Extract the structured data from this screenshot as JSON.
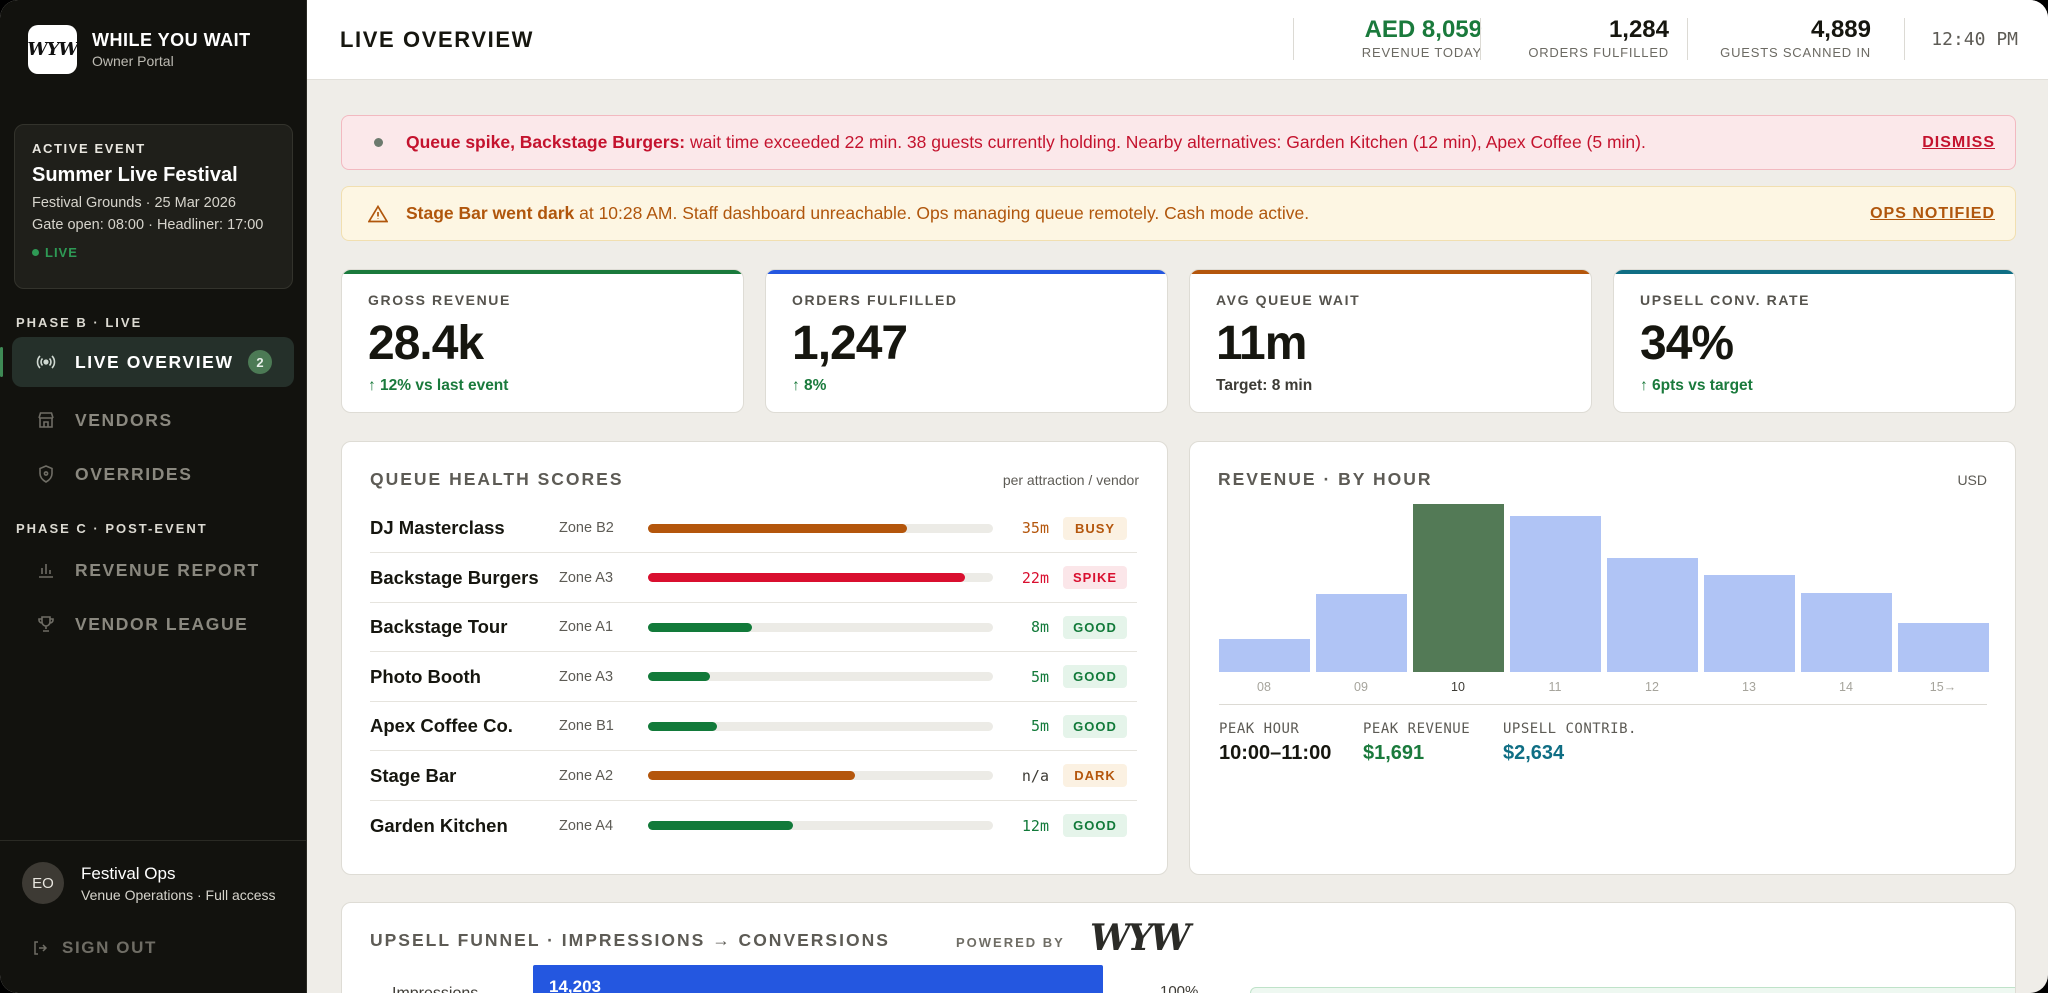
{
  "brand": {
    "logo": "WYW",
    "name": "WHILE YOU WAIT",
    "subtitle": "Owner Portal"
  },
  "event": {
    "kicker": "ACTIVE EVENT",
    "name": "Summer Live Festival",
    "venue_date": "Festival Grounds · 25 Mar 2026",
    "times": "Gate open: 08:00 · Headliner: 17:00",
    "status": "LIVE"
  },
  "nav": {
    "phase_b": "PHASE B · LIVE",
    "phase_c": "PHASE C · POST-EVENT",
    "items": [
      {
        "label": "LIVE OVERVIEW",
        "icon": "broadcast-icon",
        "badge": "2",
        "active": true
      },
      {
        "label": "VENDORS",
        "icon": "store-icon"
      },
      {
        "label": "OVERRIDES",
        "icon": "shield-icon"
      },
      {
        "label": "REVENUE REPORT",
        "icon": "bar-chart-icon"
      },
      {
        "label": "VENDOR LEAGUE",
        "icon": "trophy-icon"
      }
    ]
  },
  "user": {
    "initials": "EO",
    "name": "Festival Ops",
    "role": "Venue Operations · Full access",
    "signout": "SIGN OUT"
  },
  "header": {
    "title": "LIVE OVERVIEW",
    "stats": [
      {
        "value": "AED 8,059",
        "label": "REVENUE TODAY"
      },
      {
        "value": "1,284",
        "label": "ORDERS FULFILLED"
      },
      {
        "value": "4,889",
        "label": "GUESTS SCANNED IN"
      }
    ],
    "clock": "12:40 PM"
  },
  "alerts": {
    "queue": {
      "bold": "Queue spike, Backstage Burgers:",
      "text": " wait time exceeded 22 min. 38 guests currently holding. Nearby alternatives: Garden Kitchen (12 min), Apex Coffee (5 min).",
      "action": "DISMISS"
    },
    "stage": {
      "bold": "Stage Bar went dark",
      "text": " at 10:28 AM. Staff dashboard unreachable. Ops managing queue remotely. Cash mode active.",
      "action": "OPS NOTIFIED"
    }
  },
  "kpis": [
    {
      "label": "GROSS REVENUE",
      "value": "28.4k",
      "sub": "↑ 12% vs last event",
      "accent": "#1a7a3c",
      "sub_color": "#1a7a3c"
    },
    {
      "label": "ORDERS FULFILLED",
      "value": "1,247",
      "sub": "↑ 8%",
      "accent": "#2457e0",
      "sub_color": "#1a7a3c"
    },
    {
      "label": "AVG QUEUE WAIT",
      "value": "11m",
      "sub": "Target: 8 min",
      "accent": "#b4560c",
      "sub_color": "#3d3b35"
    },
    {
      "label": "UPSELL CONV. RATE",
      "value": "34%",
      "sub": "↑ 6pts vs target",
      "accent": "#0f6e84",
      "sub_color": "#1a7a3c"
    }
  ],
  "queue": {
    "title": "QUEUE HEALTH SCORES",
    "note": "per attraction / vendor",
    "rows": [
      {
        "name": "DJ Masterclass",
        "zone": "Zone B2",
        "fill": 0.75,
        "time": "35m",
        "status": "BUSY",
        "color": "#b4560c",
        "tag_bg": "#fbf1e2"
      },
      {
        "name": "Backstage Burgers",
        "zone": "Zone A3",
        "fill": 0.92,
        "time": "22m",
        "status": "SPIKE",
        "color": "#d90f2f",
        "tag_bg": "#fbe6e9"
      },
      {
        "name": "Backstage Tour",
        "zone": "Zone A1",
        "fill": 0.3,
        "time": "8m",
        "status": "GOOD",
        "color": "#127a3a",
        "tag_bg": "#e5f4ea"
      },
      {
        "name": "Photo Booth",
        "zone": "Zone A3",
        "fill": 0.18,
        "time": "5m",
        "status": "GOOD",
        "color": "#127a3a",
        "tag_bg": "#e5f4ea"
      },
      {
        "name": "Apex Coffee Co.",
        "zone": "Zone B1",
        "fill": 0.2,
        "time": "5m",
        "status": "GOOD",
        "color": "#127a3a",
        "tag_bg": "#e5f4ea"
      },
      {
        "name": "Stage Bar",
        "zone": "Zone A2",
        "fill": 0.6,
        "time": "n/a",
        "status": "DARK",
        "color": "#b4560c",
        "tag_bg": "#fbf1e2",
        "time_color": "#3d3b35"
      },
      {
        "name": "Garden Kitchen",
        "zone": "Zone A4",
        "fill": 0.42,
        "time": "12m",
        "status": "GOOD",
        "color": "#127a3a",
        "tag_bg": "#e5f4ea"
      }
    ]
  },
  "revenue": {
    "title": "REVENUE · BY HOUR",
    "unit": "USD",
    "stats": [
      {
        "label": "PEAK HOUR",
        "value": "10:00–11:00",
        "color": "#16160f"
      },
      {
        "label": "PEAK REVENUE",
        "value": "$1,691",
        "color": "#1a7a3c"
      },
      {
        "label": "UPSELL CONTRIB.",
        "value": "$2,634",
        "color": "#0f6e84"
      }
    ]
  },
  "chart_data": {
    "type": "bar",
    "title": "REVENUE · BY HOUR",
    "categories": [
      "08",
      "09",
      "10",
      "11",
      "12",
      "13",
      "14",
      "15→"
    ],
    "values": [
      330,
      790,
      1691,
      1570,
      1150,
      980,
      800,
      490
    ],
    "highlight": "10",
    "colors": {
      "bar": "#b0c4f5",
      "peak": "#537a56"
    }
  },
  "funnel": {
    "title": "UPSELL FUNNEL · IMPRESSIONS → CONVERSIONS",
    "powered_by": "POWERED BY",
    "logo": "WYW",
    "row_label": "Impressions",
    "row_value": "14,203",
    "row_pct": "100%"
  }
}
